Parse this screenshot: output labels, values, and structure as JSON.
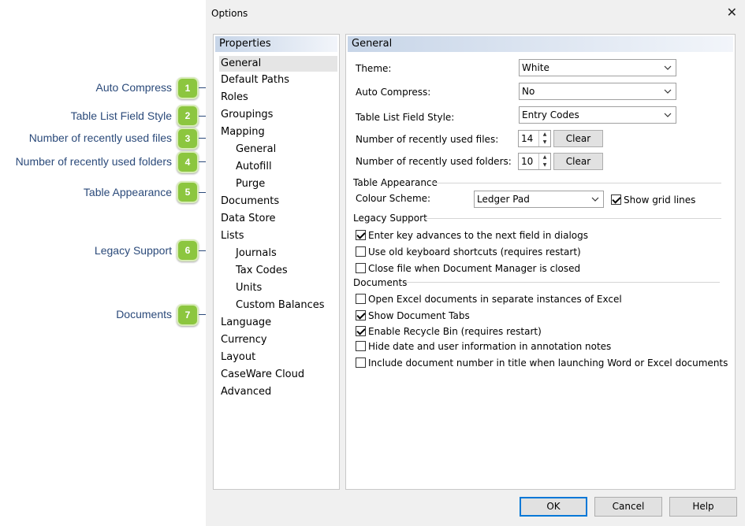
{
  "dialog": {
    "title": "Options"
  },
  "callouts": [
    {
      "num": "1",
      "label": "Auto Compress"
    },
    {
      "num": "2",
      "label": "Table List Field Style"
    },
    {
      "num": "3",
      "label": "Number of recently used files"
    },
    {
      "num": "4",
      "label": "Number of recently used folders"
    },
    {
      "num": "5",
      "label": "Table Appearance"
    },
    {
      "num": "6",
      "label": "Legacy Support"
    },
    {
      "num": "7",
      "label": "Documents"
    }
  ],
  "properties": {
    "header": "Properties",
    "items": [
      "General",
      "Default Paths",
      "Roles",
      "Groupings",
      "Mapping",
      "General",
      "Autofill",
      "Purge",
      "Documents",
      "Data Store",
      "Lists",
      "Journals",
      "Tax Codes",
      "Units",
      "Custom Balances",
      "Language",
      "Currency",
      "Layout",
      "CaseWare Cloud",
      "Advanced"
    ]
  },
  "general": {
    "header": "General",
    "theme": {
      "label": "Theme:",
      "value": "White"
    },
    "auto_compress": {
      "label": "Auto Compress:",
      "value": "No"
    },
    "table_list_field_style": {
      "label": "Table List Field Style:",
      "value": "Entry Codes"
    },
    "recent_files": {
      "label": "Number of recently used files:",
      "value": "14",
      "clear": "Clear"
    },
    "recent_folders": {
      "label": "Number of recently used folders:",
      "value": "10",
      "clear": "Clear"
    },
    "table_appearance": {
      "title": "Table Appearance",
      "colour_scheme_label": "Colour Scheme:",
      "colour_scheme_value": "Ledger Pad",
      "show_grid_lines": {
        "label": "Show grid lines",
        "checked": true
      }
    },
    "legacy_support": {
      "title": "Legacy Support",
      "options": [
        {
          "label": "Enter key advances to the next field in dialogs",
          "checked": true
        },
        {
          "label": "Use old keyboard shortcuts (requires restart)",
          "checked": false
        },
        {
          "label": "Close file when Document Manager is closed",
          "checked": false
        }
      ]
    },
    "documents": {
      "title": "Documents",
      "options": [
        {
          "label": "Open Excel documents in separate instances of Excel",
          "checked": false
        },
        {
          "label": "Show Document Tabs",
          "checked": true
        },
        {
          "label": "Enable Recycle Bin (requires restart)",
          "checked": true
        },
        {
          "label": "Hide date and user information in annotation notes",
          "checked": false
        },
        {
          "label": "Include document number in title when launching Word or Excel documents",
          "checked": false
        }
      ]
    }
  },
  "footer": {
    "ok": "OK",
    "cancel": "Cancel",
    "help": "Help"
  }
}
